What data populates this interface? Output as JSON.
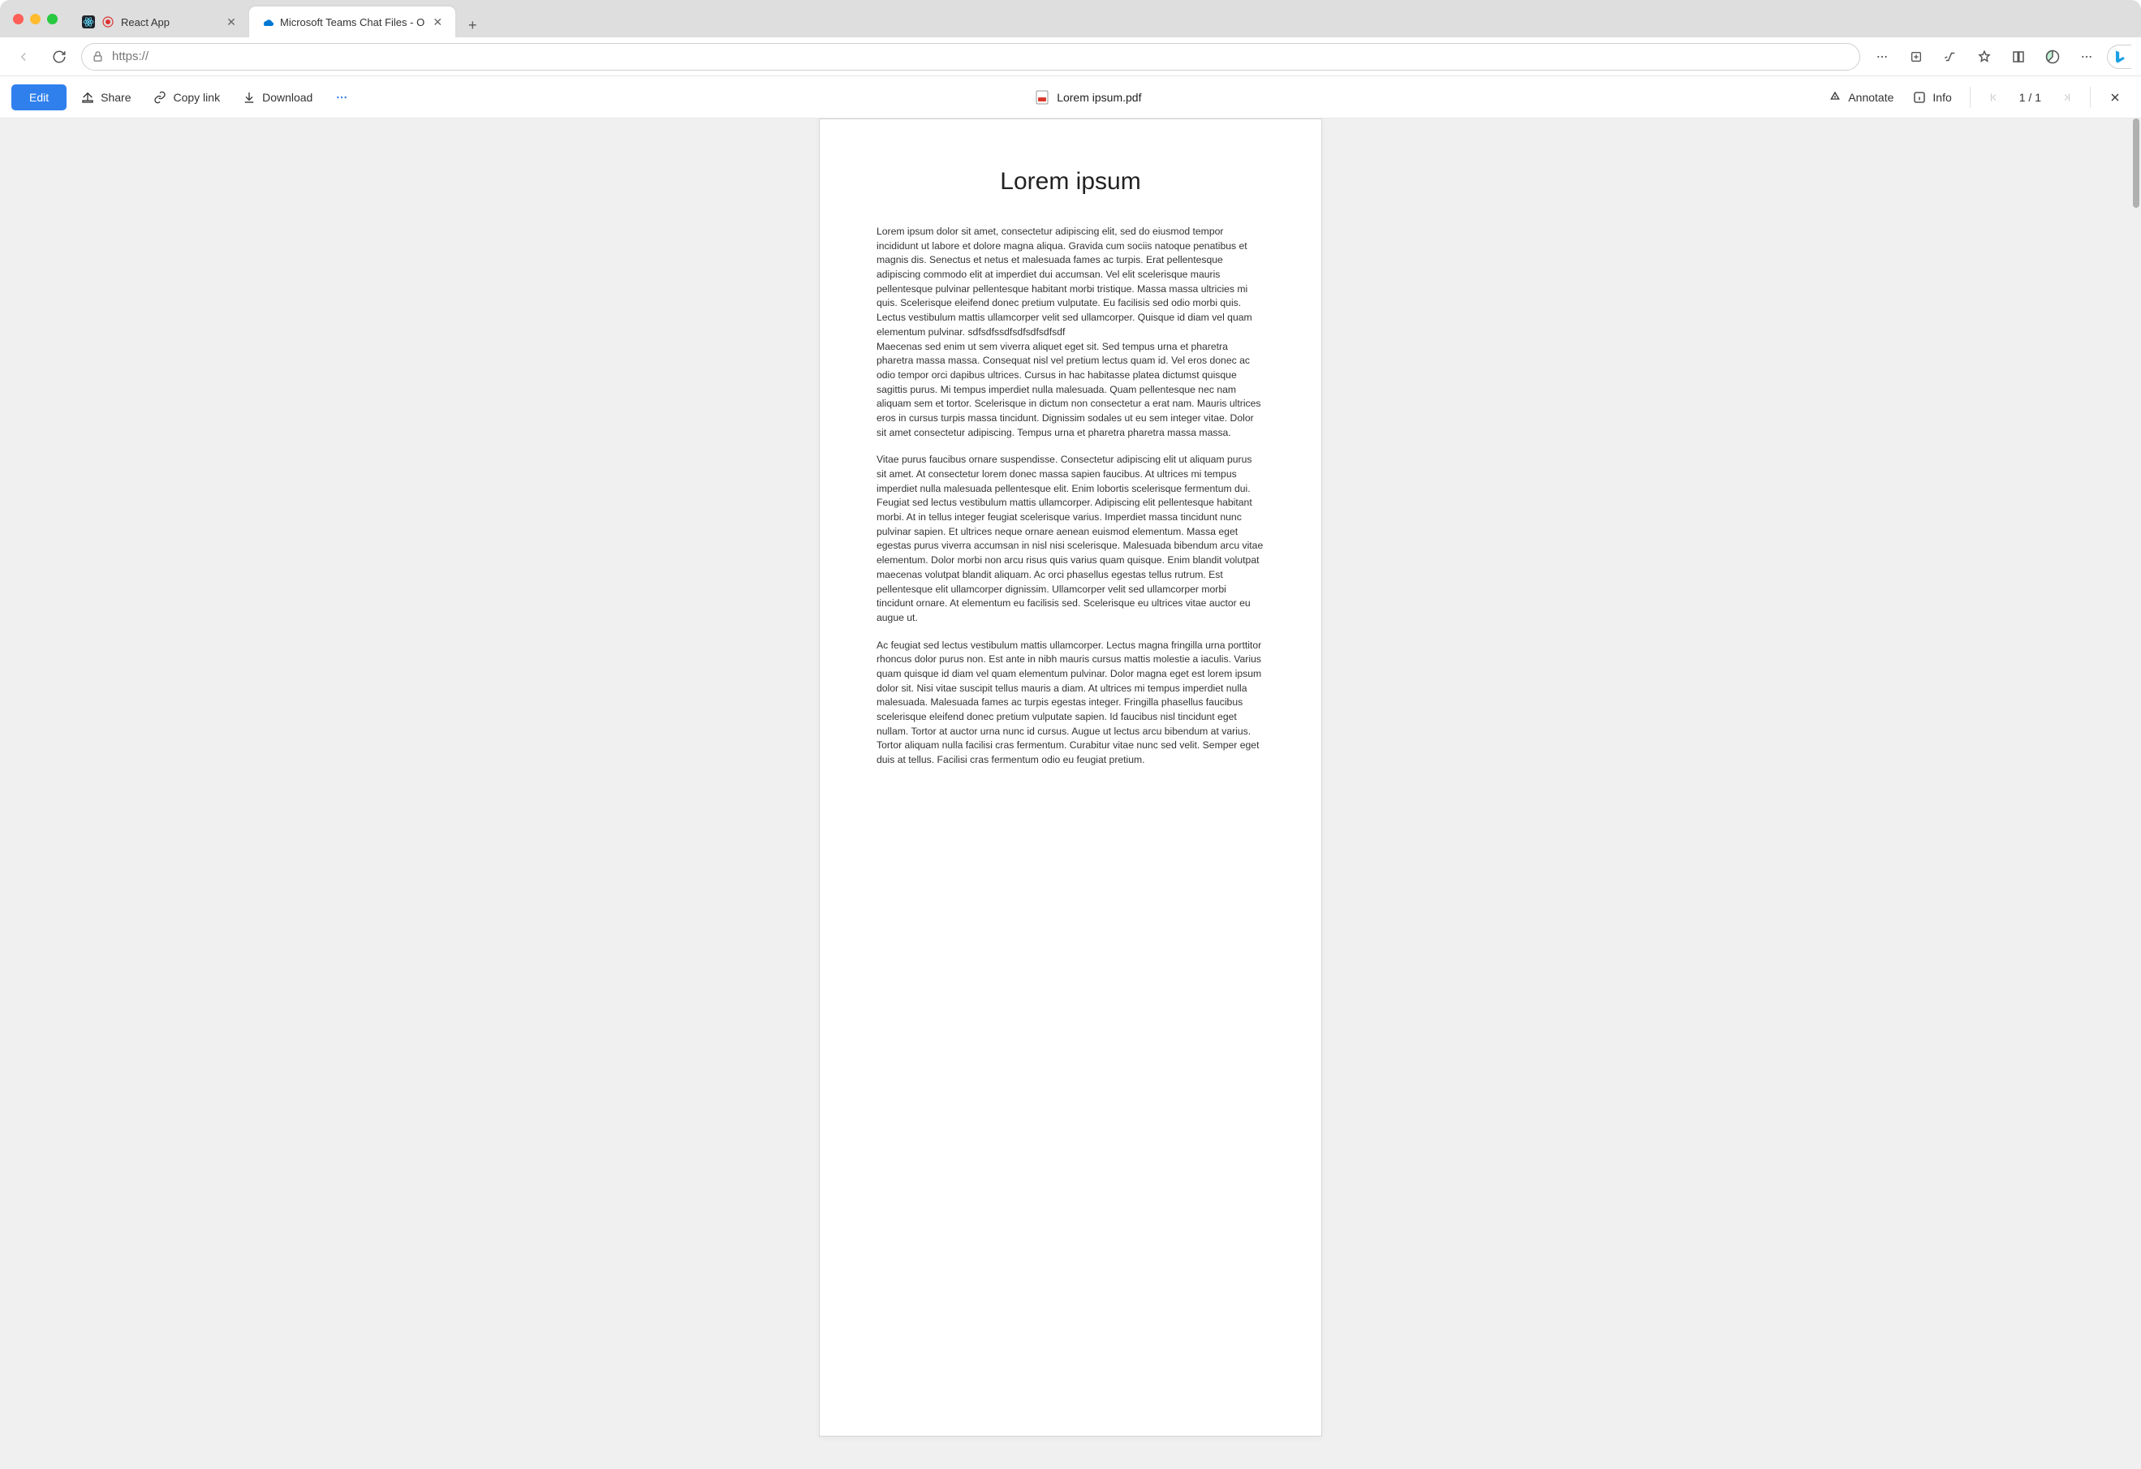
{
  "tabs": [
    {
      "title": "React App",
      "favicon": "react",
      "active": false
    },
    {
      "title": "Microsoft Teams Chat Files - O",
      "favicon": "onedrive",
      "active": true
    }
  ],
  "address_bar": {
    "value": "https://"
  },
  "doc_toolbar": {
    "edit": "Edit",
    "share": "Share",
    "copy_link": "Copy link",
    "download": "Download",
    "filename": "Lorem ipsum.pdf",
    "annotate": "Annotate",
    "info": "Info",
    "page_counter": "1 / 1"
  },
  "document": {
    "title": "Lorem ipsum",
    "paragraphs": [
      "Lorem ipsum dolor sit amet, consectetur adipiscing elit, sed do eiusmod tempor incididunt ut labore et dolore magna aliqua. Gravida cum sociis natoque penatibus et magnis dis. Senectus et netus et malesuada fames ac turpis. Erat pellentesque adipiscing commodo elit at imperdiet dui accumsan. Vel elit scelerisque mauris pellentesque pulvinar pellentesque habitant morbi tristique. Massa massa ultricies mi quis. Scelerisque eleifend donec pretium vulputate. Eu facilisis sed odio morbi quis. Lectus vestibulum mattis ullamcorper velit sed ullamcorper. Quisque id diam vel quam elementum pulvinar. sdfsdfssdfsdfsdfsdfsdf",
      "Maecenas sed enim ut sem viverra aliquet eget sit. Sed tempus urna et pharetra pharetra massa massa. Consequat nisl vel pretium lectus quam id. Vel eros donec ac odio tempor orci dapibus ultrices. Cursus in hac habitasse platea dictumst quisque sagittis purus. Mi tempus imperdiet nulla malesuada. Quam pellentesque nec nam aliquam sem et tortor. Scelerisque in dictum non consectetur a erat nam. Mauris ultrices eros in cursus turpis massa tincidunt. Dignissim sodales ut eu sem integer vitae. Dolor sit amet consectetur adipiscing. Tempus urna et pharetra pharetra massa massa.",
      "Vitae purus faucibus ornare suspendisse. Consectetur adipiscing elit ut aliquam purus sit amet. At consectetur lorem donec massa sapien faucibus. At ultrices mi tempus imperdiet nulla malesuada pellentesque elit. Enim lobortis scelerisque fermentum dui. Feugiat sed lectus vestibulum mattis ullamcorper. Adipiscing elit pellentesque habitant morbi. At in tellus integer feugiat scelerisque varius. Imperdiet massa tincidunt nunc pulvinar sapien. Et ultrices neque ornare aenean euismod elementum. Massa eget egestas purus viverra accumsan in nisl nisi scelerisque. Malesuada bibendum arcu vitae elementum. Dolor morbi non arcu risus quis varius quam quisque. Enim blandit volutpat maecenas volutpat blandit aliquam. Ac orci phasellus egestas tellus rutrum. Est pellentesque elit ullamcorper dignissim. Ullamcorper velit sed ullamcorper morbi tincidunt ornare. At elementum eu facilisis sed. Scelerisque eu ultrices vitae auctor eu augue ut.",
      "Ac feugiat sed lectus vestibulum mattis ullamcorper. Lectus magna fringilla urna porttitor rhoncus dolor purus non. Est ante in nibh mauris cursus mattis molestie a iaculis. Varius quam quisque id diam vel quam elementum pulvinar. Dolor magna eget est lorem ipsum dolor sit. Nisi vitae suscipit tellus mauris a diam. At ultrices mi tempus imperdiet nulla malesuada. Malesuada fames ac turpis egestas integer. Fringilla phasellus faucibus scelerisque eleifend donec pretium vulputate sapien. Id faucibus nisl tincidunt eget nullam. Tortor at auctor urna nunc id cursus. Augue ut lectus arcu bibendum at varius. Tortor aliquam nulla facilisi cras fermentum. Curabitur vitae nunc sed velit. Semper eget duis at tellus. Facilisi cras fermentum odio eu feugiat pretium."
    ]
  }
}
